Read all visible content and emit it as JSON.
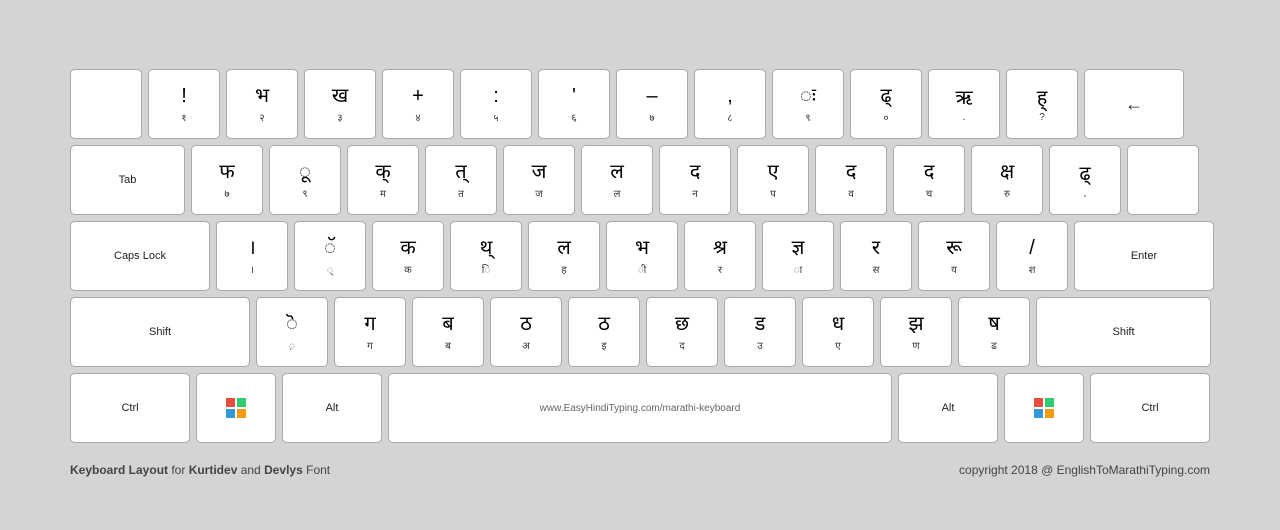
{
  "keyboard": {
    "title": "Keyboard Layout for Kurtidev and Devlys Font",
    "copyright": "copyright 2018 @ EnglishToMarathiTyping.com",
    "website": "www.EasyHindiTyping.com/marathi-keyboard",
    "rows": [
      {
        "keys": [
          {
            "id": "backtick",
            "top": "",
            "bottom": ""
          },
          {
            "id": "1",
            "top": "!",
            "bottom": "१"
          },
          {
            "id": "2",
            "top": "भ",
            "bottom": "२"
          },
          {
            "id": "3",
            "top": "ख",
            "bottom": "३"
          },
          {
            "id": "4",
            "top": "+",
            "bottom": "४"
          },
          {
            "id": "5",
            "top": ":",
            "bottom": "५"
          },
          {
            "id": "6",
            "top": "'",
            "bottom": "६"
          },
          {
            "id": "7",
            "top": "–",
            "bottom": "७"
          },
          {
            "id": "8",
            "top": ",",
            "bottom": "८"
          },
          {
            "id": "9",
            "top": "ः",
            "bottom": "९"
          },
          {
            "id": "0",
            "top": "ढ्",
            "bottom": "०"
          },
          {
            "id": "minus",
            "top": "ऋ",
            "bottom": "."
          },
          {
            "id": "equals",
            "top": "ह्",
            "bottom": "?"
          },
          {
            "id": "backspace",
            "label": "←",
            "wide": "backspace"
          }
        ]
      },
      {
        "keys": [
          {
            "id": "tab",
            "label": "Tab",
            "wide": "tab"
          },
          {
            "id": "q",
            "top": "फ",
            "bottom": "७"
          },
          {
            "id": "w",
            "top": "ू",
            "bottom": "९"
          },
          {
            "id": "e",
            "top": "क",
            "bottom": "म"
          },
          {
            "id": "r",
            "top": "त",
            "bottom": "त"
          },
          {
            "id": "t",
            "top": "ज",
            "bottom": "ज"
          },
          {
            "id": "y",
            "top": "ल",
            "bottom": "ल"
          },
          {
            "id": "u",
            "top": "द",
            "bottom": "न"
          },
          {
            "id": "i",
            "top": "ए",
            "bottom": "प"
          },
          {
            "id": "o",
            "top": "द",
            "bottom": "व"
          },
          {
            "id": "p",
            "top": "द",
            "bottom": "च"
          },
          {
            "id": "lbracket",
            "top": "क्ष",
            "bottom": "रु"
          },
          {
            "id": "rbracket",
            "top": "ढ्",
            "bottom": ","
          },
          {
            "id": "backslash",
            "top": "",
            "bottom": "",
            "wide": "none"
          }
        ]
      },
      {
        "keys": [
          {
            "id": "capslock",
            "label": "Caps Lock",
            "wide": "caps"
          },
          {
            "id": "a",
            "top": "।",
            "bottom": "।"
          },
          {
            "id": "s",
            "top": "ॅ",
            "bottom": "्"
          },
          {
            "id": "d",
            "top": "क",
            "bottom": "क"
          },
          {
            "id": "f",
            "top": "थ्",
            "bottom": "ि"
          },
          {
            "id": "g",
            "top": "ल",
            "bottom": "ह"
          },
          {
            "id": "h",
            "top": "भ",
            "bottom": "ी"
          },
          {
            "id": "j",
            "top": "श्र",
            "bottom": "र"
          },
          {
            "id": "k",
            "top": "ज्ञ",
            "bottom": "ा"
          },
          {
            "id": "l",
            "top": "र",
            "bottom": "स"
          },
          {
            "id": "semicolon",
            "top": "रू",
            "bottom": "य"
          },
          {
            "id": "quote",
            "top": "/",
            "bottom": "श"
          },
          {
            "id": "enter",
            "label": "Enter",
            "wide": "enter"
          }
        ]
      },
      {
        "keys": [
          {
            "id": "lshift",
            "label": "Shift",
            "wide": "shift-l"
          },
          {
            "id": "z",
            "top": "ॆ",
            "bottom": "़"
          },
          {
            "id": "x",
            "top": "ग",
            "bottom": "ग"
          },
          {
            "id": "c",
            "top": "ब",
            "bottom": "ब"
          },
          {
            "id": "v",
            "top": "ठ",
            "bottom": "अ"
          },
          {
            "id": "b",
            "top": "ठ",
            "bottom": "इ"
          },
          {
            "id": "n",
            "top": "छ",
            "bottom": "द"
          },
          {
            "id": "m",
            "top": "ड",
            "bottom": "उ"
          },
          {
            "id": "comma",
            "top": "ध",
            "bottom": "ए"
          },
          {
            "id": "period",
            "top": "झ",
            "bottom": "ण"
          },
          {
            "id": "slash",
            "top": "ष",
            "bottom": "ढ"
          },
          {
            "id": "rshift",
            "label": "Shift",
            "wide": "shift-r"
          }
        ]
      },
      {
        "keys": [
          {
            "id": "lctrl",
            "label": "Ctrl",
            "wide": "ctrl"
          },
          {
            "id": "lwin",
            "label": "win",
            "wide": "win"
          },
          {
            "id": "lalt",
            "label": "Alt",
            "wide": "alt"
          },
          {
            "id": "space",
            "label": "",
            "wide": "space"
          },
          {
            "id": "ralt",
            "label": "Alt",
            "wide": "alt"
          },
          {
            "id": "rwin",
            "label": "win",
            "wide": "win"
          },
          {
            "id": "rctrl",
            "label": "Ctrl",
            "wide": "ctrl"
          }
        ]
      }
    ]
  }
}
